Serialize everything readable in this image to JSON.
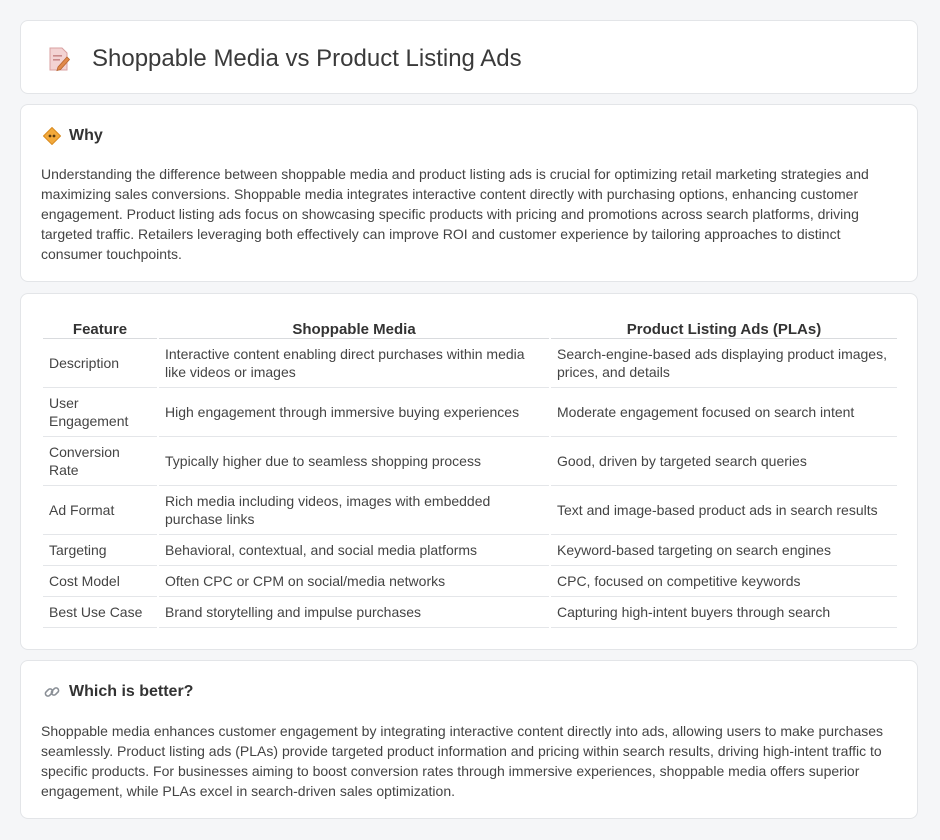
{
  "header": {
    "title": "Shoppable Media vs Product Listing Ads",
    "icon": "document-pencil-icon"
  },
  "why": {
    "title": "Why",
    "icon": "diamond-sign-icon",
    "text": "Understanding the difference between shoppable media and product listing ads is crucial for optimizing retail marketing strategies and maximizing sales conversions. Shoppable media integrates interactive content directly with purchasing options, enhancing customer engagement. Product listing ads focus on showcasing specific products with pricing and promotions across search platforms, driving targeted traffic. Retailers leveraging both effectively can improve ROI and customer experience by tailoring approaches to distinct consumer touchpoints."
  },
  "table": {
    "headers": [
      "Feature",
      "Shoppable Media",
      "Product Listing Ads (PLAs)"
    ],
    "rows": [
      [
        "Description",
        "Interactive content enabling direct purchases within media like videos or images",
        "Search-engine-based ads displaying product images, prices, and details"
      ],
      [
        "User Engagement",
        "High engagement through immersive buying experiences",
        "Moderate engagement focused on search intent"
      ],
      [
        "Conversion Rate",
        "Typically higher due to seamless shopping process",
        "Good, driven by targeted search queries"
      ],
      [
        "Ad Format",
        "Rich media including videos, images with embedded purchase links",
        "Text and image-based product ads in search results"
      ],
      [
        "Targeting",
        "Behavioral, contextual, and social media platforms",
        "Keyword-based targeting on search engines"
      ],
      [
        "Cost Model",
        "Often CPC or CPM on social/media networks",
        "CPC, focused on competitive keywords"
      ],
      [
        "Best Use Case",
        "Brand storytelling and impulse purchases",
        "Capturing high-intent buyers through search"
      ]
    ]
  },
  "better": {
    "title": "Which is better?",
    "icon": "link-icon",
    "text": "Shoppable media enhances customer engagement by integrating interactive content directly into ads, allowing users to make purchases seamlessly. Product listing ads (PLAs) provide targeted product information and pricing within search results, driving high-intent traffic to specific products. For businesses aiming to boost conversion rates through immersive experiences, shoppable media offers superior engagement, while PLAs excel in search-driven sales optimization."
  }
}
